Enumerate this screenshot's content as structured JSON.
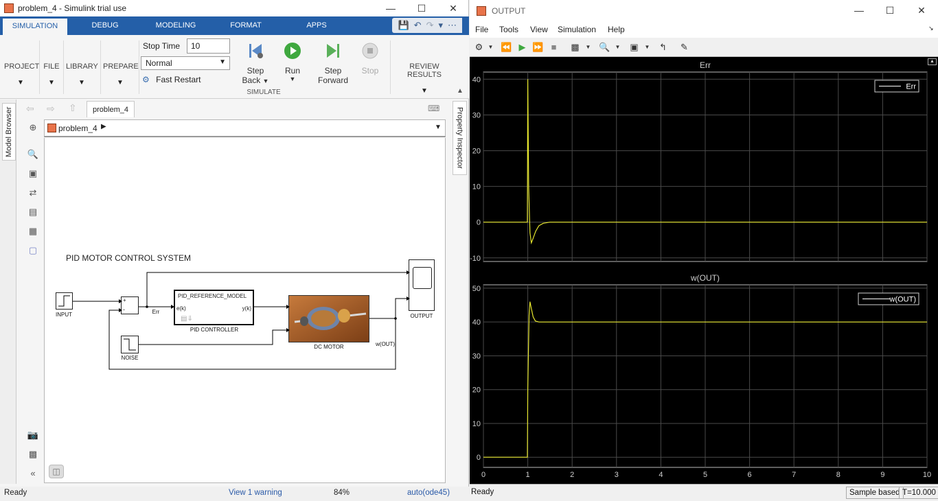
{
  "simulink": {
    "title": "problem_4 - Simulink trial use",
    "tabs": [
      "SIMULATION",
      "DEBUG",
      "MODELING",
      "FORMAT",
      "APPS"
    ],
    "ribbon": {
      "project": "PROJECT",
      "file": "FILE",
      "library": "LIBRARY",
      "prepare": "PREPARE",
      "stop_time_label": "Stop Time",
      "stop_time_value": "10",
      "mode": "Normal",
      "fast_restart": "Fast Restart",
      "step_back": [
        "Step",
        "Back"
      ],
      "run": "Run",
      "step_forward": [
        "Step",
        "Forward"
      ],
      "stop": "Stop",
      "simulate_group": "SIMULATE",
      "review_results": "REVIEW RESULTS"
    },
    "model_browser": "Model Browser",
    "property_inspector": "Property Inspector",
    "nav_tab": "problem_4",
    "address": "problem_4",
    "diagram": {
      "title": "PID MOTOR CONTROL SYSTEM",
      "input": "INPUT",
      "noise": "NOISE",
      "err": "Err",
      "pid_ref": "PID_REFERENCE_MODEL",
      "ek": "e(k)",
      "yk": "y(k)",
      "pid": "PID CONTROLLER",
      "motor": "DC MOTOR",
      "wout": "w(OUT)",
      "output": "OUTPUT",
      "plus": "+",
      "minus": "-"
    },
    "status": {
      "ready": "Ready",
      "warning": "View 1 warning",
      "zoom": "84%",
      "solver": "auto(ode45)"
    }
  },
  "scope": {
    "title": "OUTPUT",
    "menu": [
      "File",
      "Tools",
      "View",
      "Simulation",
      "Help"
    ],
    "status": {
      "ready": "Ready",
      "sample": "Sample based",
      "time": "T=10.000"
    }
  },
  "chart_data": [
    {
      "type": "line",
      "title": "Err",
      "legend": [
        "Err"
      ],
      "legend_position": "top-right",
      "xlim": [
        0,
        10
      ],
      "ylim": [
        -11,
        42
      ],
      "yticks": [
        -10,
        0,
        10,
        20,
        30,
        40
      ],
      "grid": true,
      "series": [
        {
          "name": "Err",
          "color": "#e6e62e",
          "x": [
            0,
            0.99,
            1.0,
            1.02,
            1.05,
            1.08,
            1.12,
            1.18,
            1.25,
            1.35,
            1.5,
            2,
            10
          ],
          "y": [
            0,
            0,
            40,
            10,
            -3,
            -5.8,
            -4.5,
            -2.5,
            -1,
            -0.3,
            0,
            0,
            0
          ]
        }
      ]
    },
    {
      "type": "line",
      "title": "w(OUT)",
      "legend": [
        "w(OUT)"
      ],
      "legend_position": "top-right",
      "xlim": [
        0,
        10
      ],
      "ylim": [
        -3,
        51
      ],
      "yticks": [
        0,
        10,
        20,
        30,
        40,
        50
      ],
      "xticks": [
        0,
        1,
        2,
        3,
        4,
        5,
        6,
        7,
        8,
        9,
        10
      ],
      "grid": true,
      "series": [
        {
          "name": "w(OUT)",
          "color": "#e6e62e",
          "x": [
            0,
            0.99,
            1.0,
            1.03,
            1.05,
            1.08,
            1.12,
            1.17,
            1.25,
            1.35,
            1.5,
            10
          ],
          "y": [
            0,
            0,
            20,
            42,
            46,
            44,
            41.5,
            40.3,
            40,
            40,
            40,
            40
          ]
        }
      ]
    }
  ]
}
